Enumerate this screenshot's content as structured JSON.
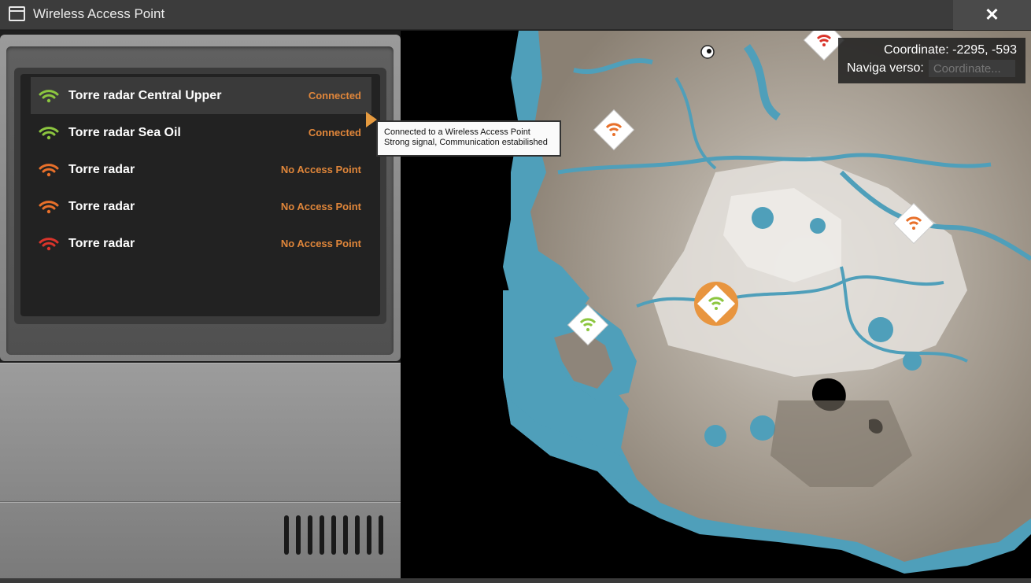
{
  "window": {
    "title": "Wireless Access Point",
    "close_label": "✕"
  },
  "access_points": [
    {
      "name": "Torre radar Central Upper",
      "status": "Connected",
      "signal_color": "#8cc63f",
      "selected": true
    },
    {
      "name": "Torre radar Sea Oil",
      "status": "Connected",
      "signal_color": "#8cc63f",
      "selected": false
    },
    {
      "name": "Torre radar",
      "status": "No Access Point",
      "signal_color": "#e8702a",
      "selected": false
    },
    {
      "name": "Torre radar",
      "status": "No Access Point",
      "signal_color": "#e8702a",
      "selected": false
    },
    {
      "name": "Torre radar",
      "status": "No Access Point",
      "signal_color": "#d9342b",
      "selected": false
    }
  ],
  "tooltip": {
    "line1": "Connected to a Wireless Access Point",
    "line2": "Strong signal, Communication estabilished"
  },
  "map": {
    "coordinate_label": "Coordinate: -2295, -593",
    "navigate_label": "Naviga verso:",
    "navigate_placeholder": "Coordinate..."
  },
  "colors": {
    "connected": "#8cc63f",
    "warning": "#e8702a",
    "danger": "#d9342b",
    "status_text": "#e0863a",
    "water": "#4f9fba",
    "land": "#8a8073"
  }
}
